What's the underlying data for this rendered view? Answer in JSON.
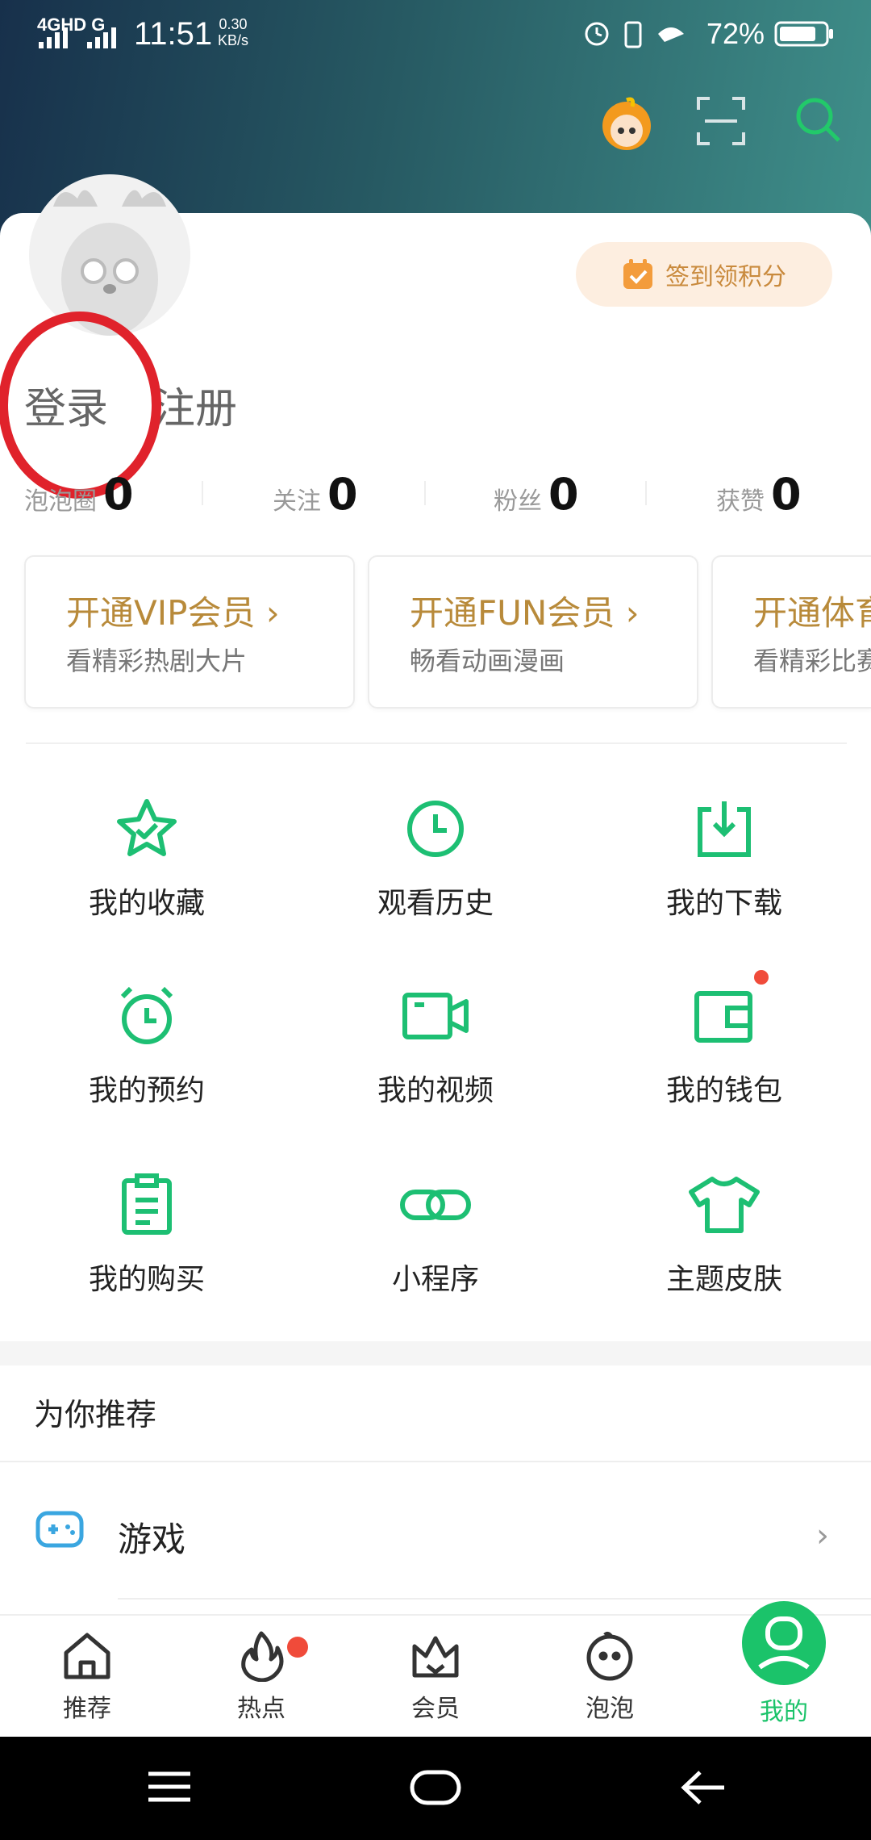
{
  "status_bar": {
    "network": "4GHD G",
    "time": "11:51",
    "speed": "0.30",
    "speed_unit": "KB/s",
    "battery_percent": "72%"
  },
  "header": {
    "icons": [
      "mascot-avatar-icon",
      "scan-icon",
      "search-icon"
    ]
  },
  "profile": {
    "checkin_label": "签到领积分",
    "login_label": "登录",
    "register_label": "注册"
  },
  "stats": [
    {
      "label": "泡泡圈",
      "value": "0"
    },
    {
      "label": "关注",
      "value": "0"
    },
    {
      "label": "粉丝",
      "value": "0"
    },
    {
      "label": "获赞",
      "value": "0"
    }
  ],
  "membership_cards": [
    {
      "title": "开通VIP会员",
      "subtitle": "看精彩热剧大片"
    },
    {
      "title": "开通FUN会员",
      "subtitle": "畅看动画漫画"
    },
    {
      "title": "开通体育",
      "subtitle": "看精彩比赛"
    }
  ],
  "grid": [
    {
      "label": "我的收藏",
      "icon": "star-check-icon"
    },
    {
      "label": "观看历史",
      "icon": "clock-icon"
    },
    {
      "label": "我的下载",
      "icon": "download-icon"
    },
    {
      "label": "我的预约",
      "icon": "alarm-clock-icon"
    },
    {
      "label": "我的视频",
      "icon": "video-camera-icon"
    },
    {
      "label": "我的钱包",
      "icon": "wallet-icon"
    },
    {
      "label": "我的购买",
      "icon": "clipboard-icon"
    },
    {
      "label": "小程序",
      "icon": "link-icon"
    },
    {
      "label": "主题皮肤",
      "icon": "tshirt-icon"
    }
  ],
  "recommend": {
    "title": "为你推荐",
    "items": [
      {
        "label": "游戏",
        "icon": "gamepad-icon"
      }
    ]
  },
  "tabs": [
    {
      "label": "推荐",
      "icon": "home-icon"
    },
    {
      "label": "热点",
      "icon": "fire-icon"
    },
    {
      "label": "会员",
      "icon": "crown-icon"
    },
    {
      "label": "泡泡",
      "icon": "bubble-face-icon"
    },
    {
      "label": "我的",
      "icon": "user-icon",
      "active": true
    }
  ],
  "colors": {
    "accent_green": "#1bc36a",
    "gold": "#b88a3a",
    "annotation_red": "#e0222b"
  }
}
